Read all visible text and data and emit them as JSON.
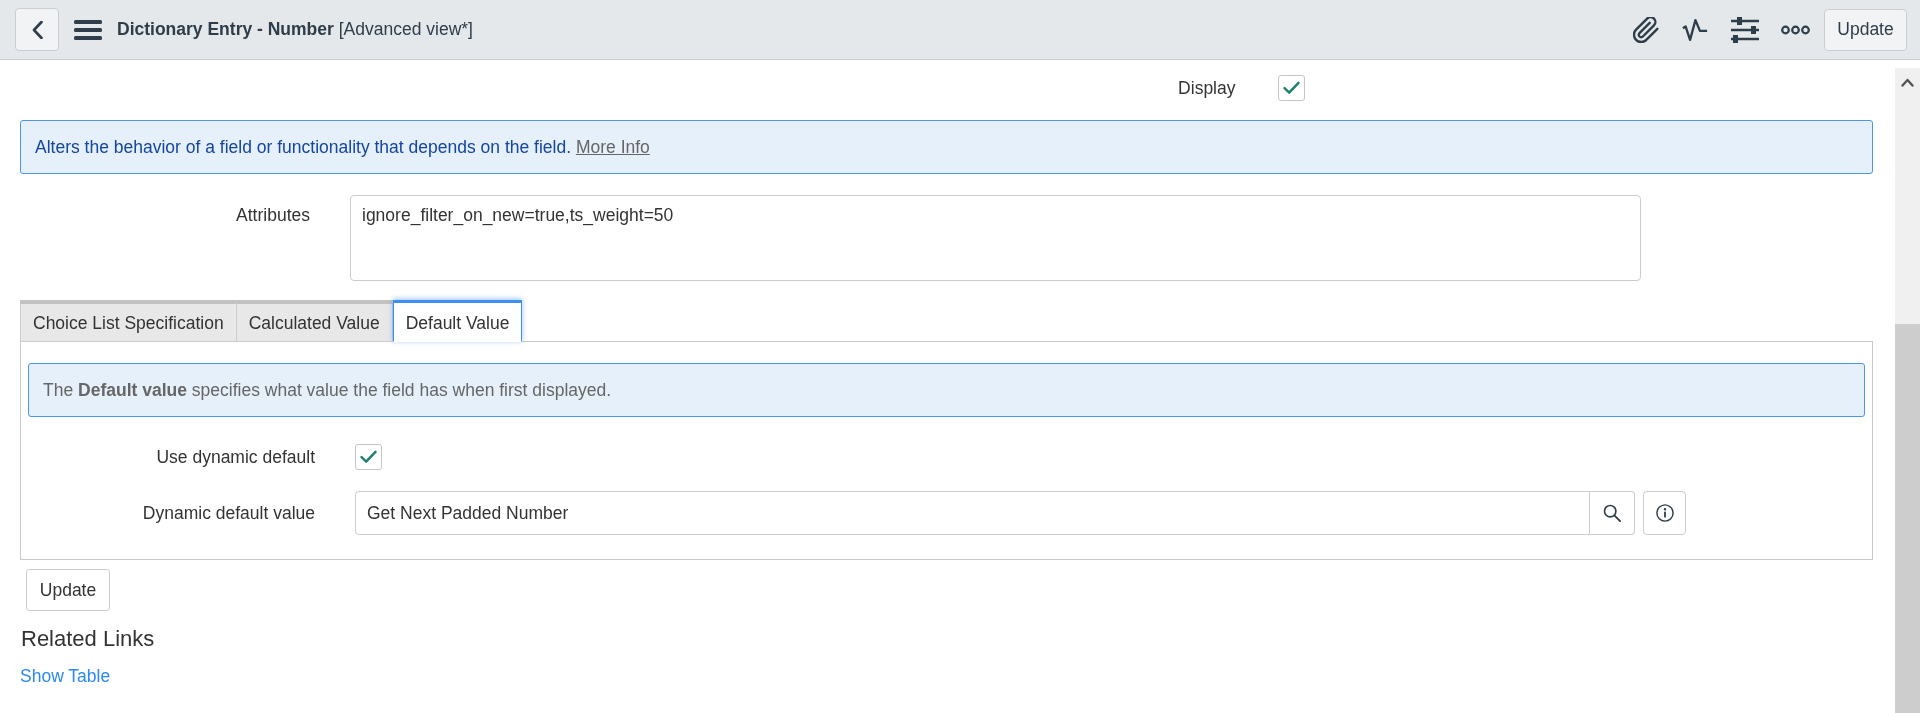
{
  "header": {
    "title": "**Dictionary Entry - Number** [Advanced view*]",
    "update_button": "Update"
  },
  "display": {
    "label": "Display",
    "checked": true
  },
  "info_message": {
    "text": "Alters the behavior of a field or functionality that depends on the field.",
    "link": "More Info"
  },
  "attributes": {
    "label": "Attributes",
    "value": "ignore_filter_on_new=true,ts_weight=50"
  },
  "tabs": [
    {
      "label": "Choice List Specification",
      "selected": false
    },
    {
      "label": "Calculated Value",
      "selected": false
    },
    {
      "label": "Default Value",
      "selected": true
    }
  ],
  "tab_panel": {
    "info": "The **Default value** specifies what value the field has when first displayed.",
    "use_dynamic_default": {
      "label": "Use dynamic default",
      "checked": true
    },
    "dynamic_default_value": {
      "label": "Dynamic default value",
      "value": "Get Next Padded Number"
    }
  },
  "update_button": "Update",
  "related_links": {
    "title": "Related Links",
    "links": [
      "Show Table"
    ]
  }
}
